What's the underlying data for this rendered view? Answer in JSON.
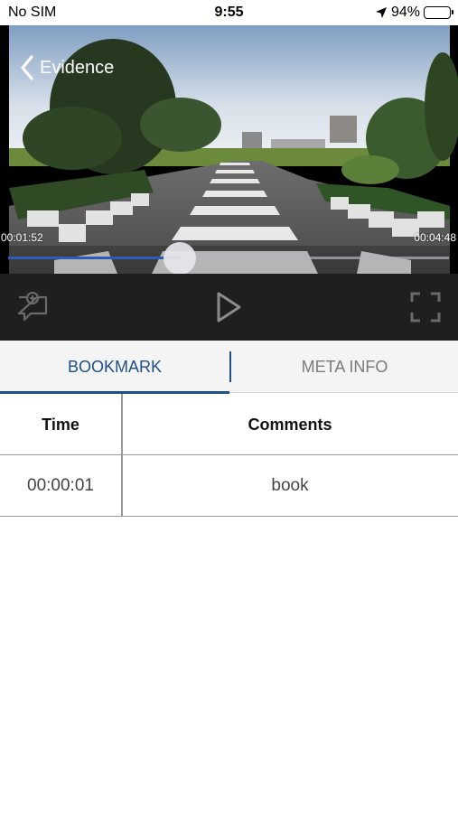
{
  "status_bar": {
    "carrier": "No SIM",
    "time": "9:55",
    "battery_percent": "94%",
    "battery_level": 0.94
  },
  "video": {
    "title": "Evidence",
    "elapsed": "00:01:52",
    "duration": "00:04:48",
    "progress_fraction": 0.389,
    "accent_color": "#2a5db8"
  },
  "controls": {
    "icons": [
      "add-bookmark-icon",
      "play-icon",
      "fullscreen-icon"
    ]
  },
  "tabs": [
    {
      "label": "BOOKMARK",
      "active": true
    },
    {
      "label": "META INFO",
      "active": false
    }
  ],
  "bookmarks": {
    "columns": [
      "Time",
      "Comments"
    ],
    "rows": [
      {
        "time": "00:00:01",
        "comment": "book"
      }
    ]
  },
  "colors": {
    "tab_active": "#1f4f86",
    "tab_inactive": "#7a7a7a",
    "controls_bg": "#1f1f1f"
  }
}
